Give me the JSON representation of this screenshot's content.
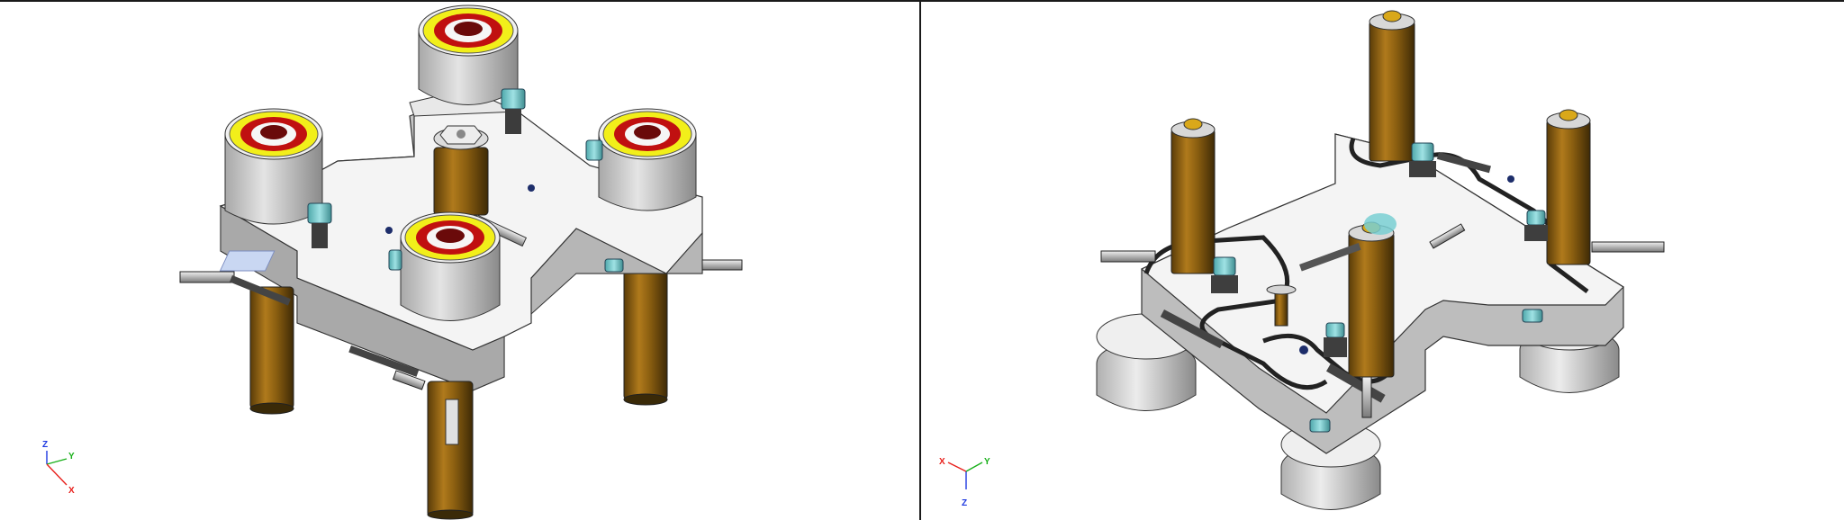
{
  "views": {
    "left": {
      "triad": {
        "x_label": "X",
        "y_label": "Y",
        "z_label": "Z"
      }
    },
    "right": {
      "triad": {
        "x_label": "X",
        "y_label": "Y",
        "z_label": "Z"
      }
    }
  },
  "colors": {
    "plate_top": "#f2f2f2",
    "plate_side": "#c8c8c8",
    "plate_dark": "#9a9a9a",
    "canister": "#d2d2d2",
    "canister_dark": "#8c8c8c",
    "ring_yellow": "#f2ef1a",
    "ring_red": "#c01010",
    "ring_dark": "#6a0a0a",
    "filter_brown": "#9a6a12",
    "filter_dark": "#4a3208",
    "fitting_cyan": "#79cfd2",
    "axis_x": "#e8201c",
    "axis_y": "#19b01a",
    "axis_z": "#1c37e0"
  }
}
